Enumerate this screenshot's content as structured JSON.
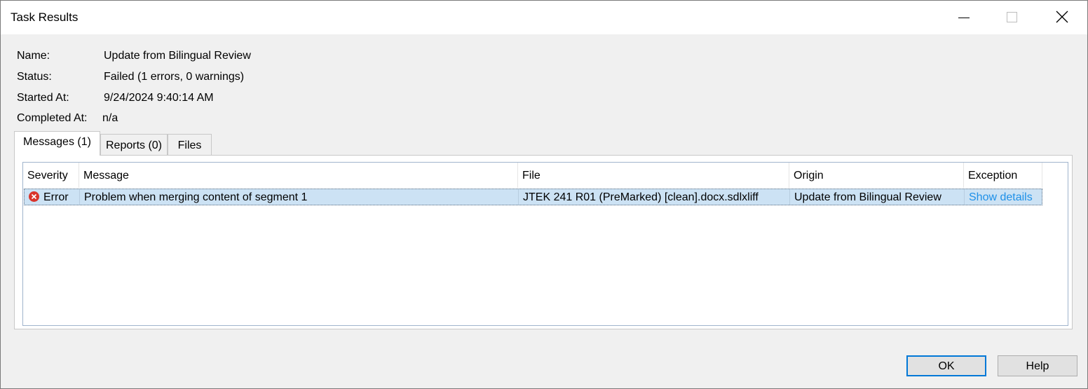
{
  "window": {
    "title": "Task Results"
  },
  "info": {
    "name_label": "Name:",
    "name_value": "Update from Bilingual Review",
    "status_label": "Status:",
    "status_value": "Failed (1 errors, 0 warnings)",
    "started_label": "Started At:",
    "started_value": "9/24/2024 9:40:14 AM",
    "completed_label": "Completed At:",
    "completed_value": "n/a"
  },
  "tabs": [
    {
      "label": "Messages (1)",
      "active": true
    },
    {
      "label": "Reports (0)",
      "active": false
    },
    {
      "label": "Files",
      "active": false
    }
  ],
  "grid": {
    "columns": [
      "Severity",
      "Message",
      "File",
      "Origin",
      "Exception"
    ],
    "rows": [
      {
        "severity": "Error",
        "message": "Problem when merging content of segment 1",
        "file": "JTEK 241 R01 (PreMarked) [clean].docx.sdlxliff",
        "origin": "Update from Bilingual Review",
        "exception": "Show details"
      }
    ]
  },
  "buttons": {
    "ok": "OK",
    "help": "Help"
  },
  "colors": {
    "error_icon": "#d9342b",
    "link": "#1e90e8",
    "selection": "#cce2f4",
    "default_button_border": "#0078d7"
  },
  "icons": {
    "severity_error": "error-circle-icon",
    "close": "close-icon",
    "minimize": "minimize-icon",
    "maximize": "maximize-icon"
  }
}
